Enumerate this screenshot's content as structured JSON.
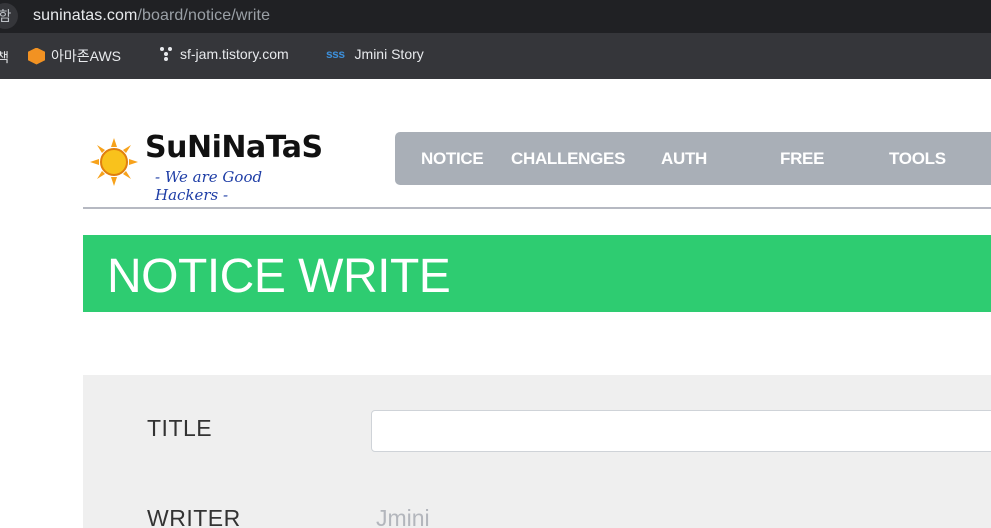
{
  "browser": {
    "url_prefix": "함",
    "url_host": "suninatas.com",
    "url_path": "/board/notice/write",
    "bookmarks_edge": "책",
    "bookmarks": [
      {
        "label": "아마존AWS",
        "icon": "aws-icon"
      },
      {
        "label": "sf-jam.tistory.com",
        "icon": "tistory-icon"
      },
      {
        "label": "Jmini Story",
        "icon": "sss-icon",
        "icon_text": "sss"
      }
    ]
  },
  "site": {
    "logo_name": "SuNiNaTaS",
    "logo_tagline": "- We are Good Hackers -",
    "nav": [
      "NOTICE",
      "CHALLENGES",
      "AUTH",
      "FREE",
      "TOOLS"
    ]
  },
  "page": {
    "title": "NOTICE WRITE"
  },
  "form": {
    "title_label": "TITLE",
    "title_value": "",
    "writer_label": "WRITER",
    "writer_value": "Jmini"
  },
  "colors": {
    "banner": "#2ecc71",
    "nav": "#a9afb7",
    "panel": "#efefef"
  }
}
